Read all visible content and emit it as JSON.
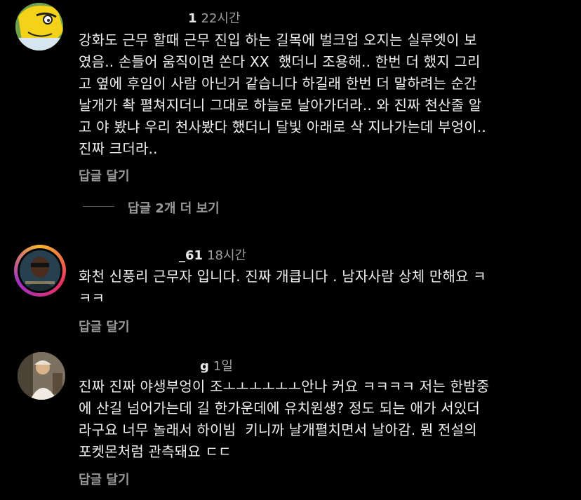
{
  "comments": [
    {
      "username": "1",
      "time": "22시간",
      "text": "강화도 근무 할때 근무 진입 하는 길목에 벌크업 오지는 실루엣이 보\n였음.. 손들어 움직이면 쏜다 XX  했더니 조용해.. 한번 더 했지 그리\n고 옆에 후임이 사람 아닌거 같습니다 하길래 한번 더 말하려는 순간\n날개가 촥 펼쳐지더니 그대로 하늘로 날아가더라.. 와 진짜 천산줄 알\n고 야 봤냐 우리 천사봤다 했더니 달빛 아래로 삭 지나가는데 부엉이..\n진짜 크더라..",
      "reply_label": "답글 달기",
      "view_more": "답글 2개 더 보기"
    },
    {
      "username": "_61",
      "time": "18시간",
      "text": "화천 신풍리 근무자 입니다. 진짜 개큽니다 . 남자사람 상체 만해요 ㅋ\nㅋㅋ",
      "reply_label": "답글 달기"
    },
    {
      "username": "g",
      "time": "1일",
      "text": "진짜 진짜 야생부엉이 조ㅗㅗㅗㅗㅗㅗ안나 커요 ㅋㅋㅋㅋ 저는 한밤중\n에 산길 넘어가는데 길 한가운데에 유치원생? 정도 되는 애가 서있더\n라구요 너무 놀래서 하이빔  키니까 날개펼치면서 날아감. 뭔 전설의\n포켓몬처럼 관측돼요 ㄷㄷ",
      "reply_label": "답글 달기"
    }
  ]
}
